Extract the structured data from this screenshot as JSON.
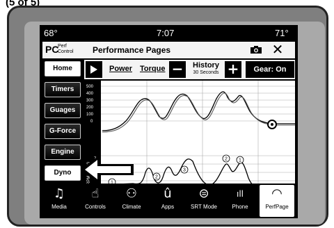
{
  "status": {
    "temp_left": "68°",
    "time": "7:07",
    "temp_right": "71°"
  },
  "header": {
    "logo": "PC",
    "logo_sub_1": "Perf",
    "logo_sub_2": "Control",
    "title": "Performance Pages",
    "camera_icon": "camera-icon",
    "close_icon": "close-icon",
    "close_glyph": "✕"
  },
  "sidebar": {
    "items": [
      {
        "label": "Home",
        "active": true
      },
      {
        "label": "Timers",
        "active": false
      },
      {
        "label": "Guages",
        "active": false
      },
      {
        "label": "G-Force",
        "active": false
      },
      {
        "label": "Engine",
        "active": false
      },
      {
        "label": "Dyno",
        "active": true
      }
    ]
  },
  "toolbar": {
    "power": "Power",
    "torque": "Torque",
    "minus": "−",
    "history": "History",
    "history_sub": "30 Seconds",
    "plus": "+",
    "gear": "Gear: On"
  },
  "graph": {
    "y_ticks_top": [
      "500",
      "400",
      "300",
      "200",
      "100",
      "0"
    ],
    "y_ticks_bottom": [
      "7",
      "6",
      "5",
      "4"
    ],
    "y_label_bottom": "RPM x 1000",
    "markers": [
      "1",
      "2",
      "3",
      "2",
      "1"
    ]
  },
  "nav": {
    "items": [
      {
        "label": "Media",
        "icon": "music-note-icon",
        "glyph": "♫"
      },
      {
        "label": "Controls",
        "icon": "controls-hand-icon",
        "glyph": "☝"
      },
      {
        "label": "Climate",
        "icon": "climate-icon",
        "glyph": "⚇"
      },
      {
        "label": "Apps",
        "icon": "apps-icon",
        "glyph": "û"
      },
      {
        "label": "SRT Mode",
        "icon": "srt-mode-icon",
        "glyph": "⊜"
      },
      {
        "label": "Phone",
        "icon": "phone-signal-icon",
        "glyph": "ıll"
      },
      {
        "label": "PerfPage",
        "icon": "perf-page-gauge-icon",
        "glyph": "◠"
      }
    ]
  },
  "figure_label": "(5 of 5)"
}
